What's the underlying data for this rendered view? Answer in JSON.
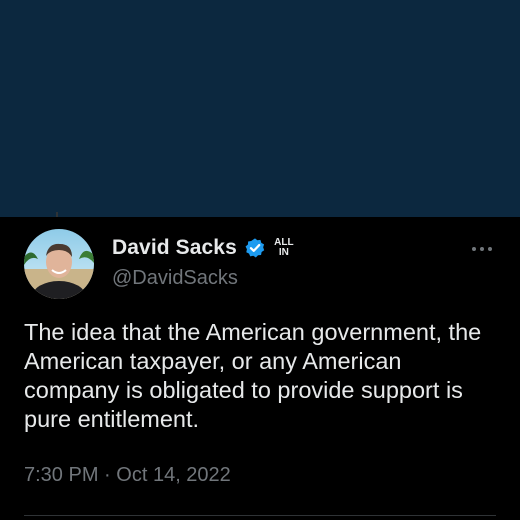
{
  "tweet": {
    "display_name": "David Sacks",
    "handle": "@DavidSacks",
    "affiliate_badge_line1": "ALL",
    "affiliate_badge_line2": "IN",
    "verified_icon": "verified-check-icon",
    "more_icon": "more-horizontal-icon",
    "body": "The idea that the American government, the American taxpayer, or any American company is obligated to provide support is pure entitlement.",
    "time": "7:30 PM",
    "separator": "·",
    "date": "Oct 14, 2022"
  },
  "colors": {
    "banner": "#0c283f",
    "background": "#000000",
    "text_primary": "#e7e9ea",
    "text_secondary": "#71767b",
    "verified_blue": "#1d9bf0"
  }
}
